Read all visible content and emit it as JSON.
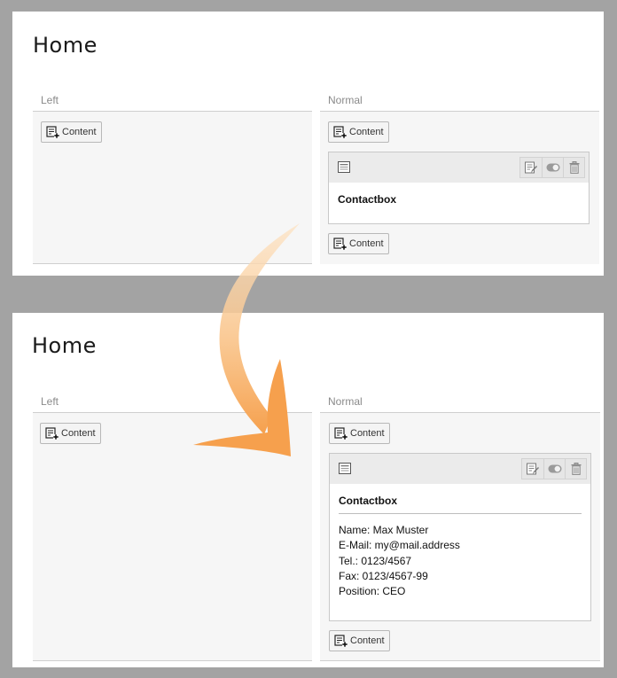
{
  "colors": {
    "panel": "#ffffff",
    "background": "#a3a3a3",
    "column": "#f6f6f6",
    "accent_arrow": "#f6a04d"
  },
  "before": {
    "title": "Home",
    "left": {
      "label": "Left",
      "add_button": "Content"
    },
    "normal": {
      "label": "Normal",
      "add_button_top": "Content",
      "element": {
        "title": "Contactbox"
      },
      "add_button_bottom": "Content"
    }
  },
  "after": {
    "title": "Home",
    "left": {
      "label": "Left",
      "add_button": "Content"
    },
    "normal": {
      "label": "Normal",
      "add_button_top": "Content",
      "element": {
        "title": "Contactbox",
        "lines": [
          "Name: Max Muster",
          "E-Mail: my@mail.address",
          "Tel.: 0123/4567",
          "Fax: 0123/4567-99",
          "Position: CEO"
        ]
      },
      "add_button_bottom": "Content"
    }
  },
  "icons": {
    "add_content": "add-content-icon",
    "element_type": "content-element-icon",
    "edit": "edit-icon",
    "toggle": "toggle-visibility-icon",
    "delete": "trash-icon"
  }
}
